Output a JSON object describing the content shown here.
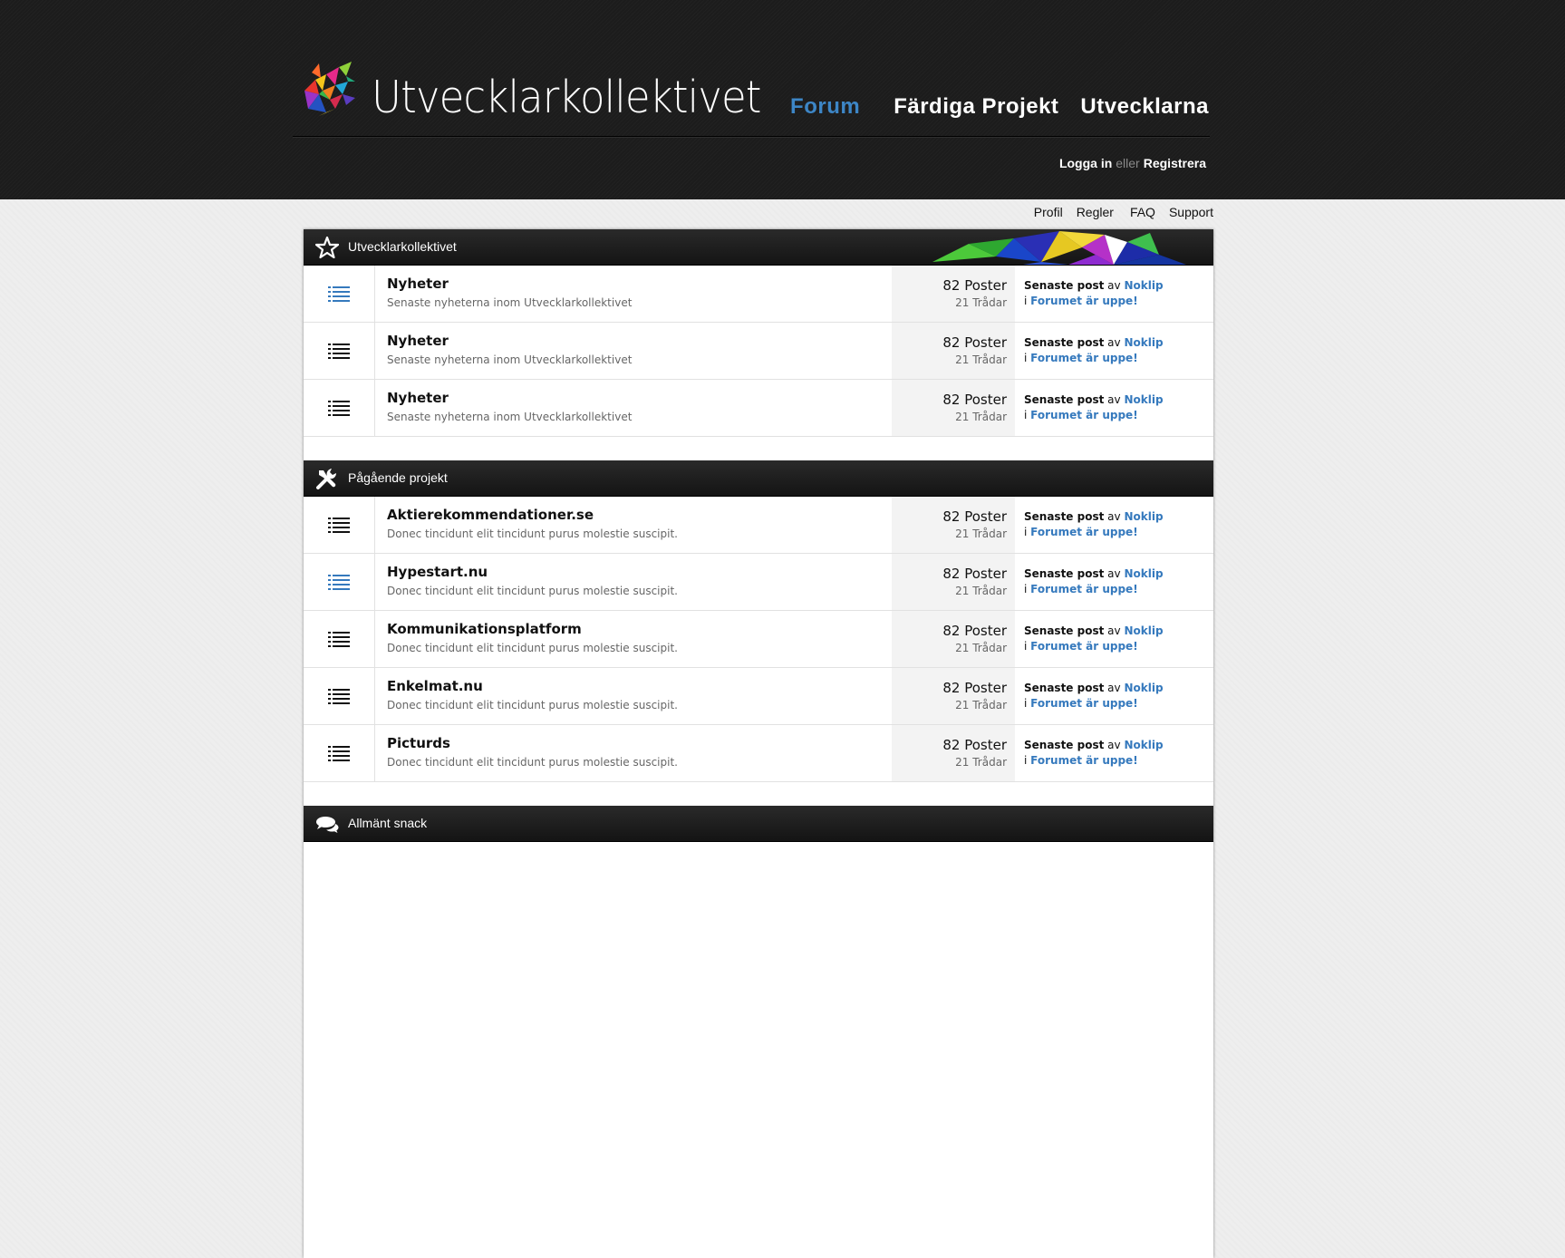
{
  "header": {
    "site_title": "Utvecklarkollektivet",
    "nav": [
      {
        "label": "Forum",
        "active": true
      },
      {
        "label": "Färdiga Projekt",
        "active": false
      },
      {
        "label": "Utvecklarna",
        "active": false
      }
    ],
    "auth": {
      "login": "Logga in",
      "or": "eller",
      "register": "Registrera"
    }
  },
  "sub_nav": [
    "Profil",
    "Regler",
    "FAQ",
    "Support"
  ],
  "colors": {
    "accent": "#3d86c6",
    "link": "#3579bd",
    "bar": "#1c1c1c"
  },
  "categories": [
    {
      "title": "Utvecklarkollektivet",
      "icon": "star-icon",
      "forums": [
        {
          "name": "Nyheter",
          "desc": "Senaste nyheterna inom Utvecklarkollektivet",
          "posts": "82 Poster",
          "threads": "21 Trådar",
          "last_prefix": "Senaste post",
          "last_av": "av",
          "last_user": "Noklip",
          "last_in": "i",
          "last_topic": "Forumet är uppe!",
          "icon_color": "#3579bd"
        },
        {
          "name": "Nyheter",
          "desc": "Senaste nyheterna inom Utvecklarkollektivet",
          "posts": "82 Poster",
          "threads": "21 Trådar",
          "last_prefix": "Senaste post",
          "last_av": "av",
          "last_user": "Noklip",
          "last_in": "i",
          "last_topic": "Forumet är uppe!",
          "icon_color": "#111111"
        },
        {
          "name": "Nyheter",
          "desc": "Senaste nyheterna inom Utvecklarkollektivet",
          "posts": "82 Poster",
          "threads": "21 Trådar",
          "last_prefix": "Senaste post",
          "last_av": "av",
          "last_user": "Noklip",
          "last_in": "i",
          "last_topic": "Forumet är uppe!",
          "icon_color": "#111111"
        }
      ]
    },
    {
      "title": "Pågående projekt",
      "icon": "tools-icon",
      "forums": [
        {
          "name": "Aktierekommendationer.se",
          "desc": "Donec tincidunt elit tincidunt purus molestie suscipit.",
          "posts": "82 Poster",
          "threads": "21 Trådar",
          "last_prefix": "Senaste post",
          "last_av": "av",
          "last_user": "Noklip",
          "last_in": "i",
          "last_topic": "Forumet är uppe!",
          "icon_color": "#111111"
        },
        {
          "name": "Hypestart.nu",
          "desc": "Donec tincidunt elit tincidunt purus molestie suscipit.",
          "posts": "82 Poster",
          "threads": "21 Trådar",
          "last_prefix": "Senaste post",
          "last_av": "av",
          "last_user": "Noklip",
          "last_in": "i",
          "last_topic": "Forumet är uppe!",
          "icon_color": "#3579bd"
        },
        {
          "name": "Kommunikationsplatform",
          "desc": "Donec tincidunt elit tincidunt purus molestie suscipit.",
          "posts": "82 Poster",
          "threads": "21 Trådar",
          "last_prefix": "Senaste post",
          "last_av": "av",
          "last_user": "Noklip",
          "last_in": "i",
          "last_topic": "Forumet är uppe!",
          "icon_color": "#111111"
        },
        {
          "name": "Enkelmat.nu",
          "desc": "Donec tincidunt elit tincidunt purus molestie suscipit.",
          "posts": "82 Poster",
          "threads": "21 Trådar",
          "last_prefix": "Senaste post",
          "last_av": "av",
          "last_user": "Noklip",
          "last_in": "i",
          "last_topic": "Forumet är uppe!",
          "icon_color": "#111111"
        },
        {
          "name": "Picturds",
          "desc": "Donec tincidunt elit tincidunt purus molestie suscipit.",
          "posts": "82 Poster",
          "threads": "21 Trådar",
          "last_prefix": "Senaste post",
          "last_av": "av",
          "last_user": "Noklip",
          "last_in": "i",
          "last_topic": "Forumet är uppe!",
          "icon_color": "#111111"
        }
      ]
    },
    {
      "title": "Allmänt snack",
      "icon": "speech-bubbles-icon",
      "forums": []
    }
  ]
}
